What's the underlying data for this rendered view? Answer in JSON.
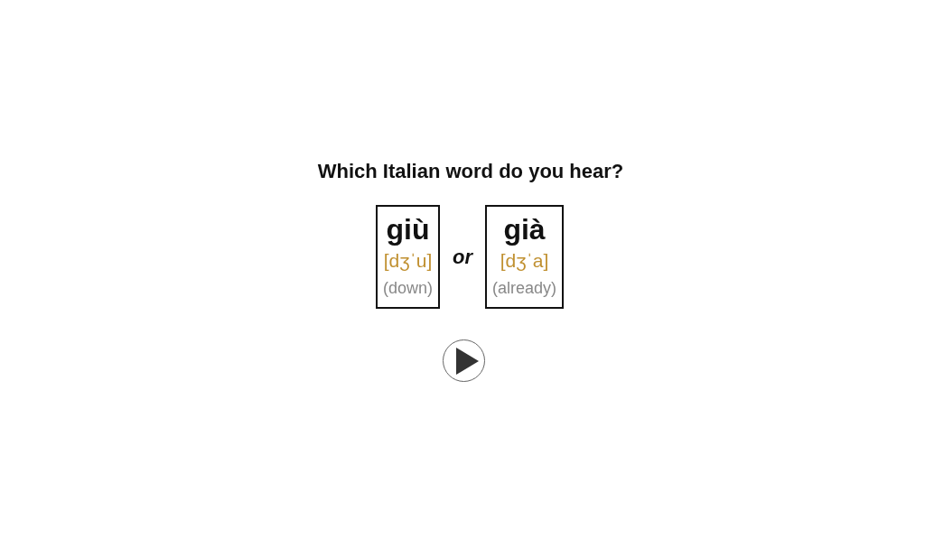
{
  "question": "Which Italian word do you hear?",
  "options": [
    {
      "word": "giù",
      "ipa": "[dʒˈu]",
      "meaning": "(down)"
    },
    {
      "word": "già",
      "ipa": "[dʒˈa]",
      "meaning": "(already)"
    }
  ],
  "separator": "or"
}
